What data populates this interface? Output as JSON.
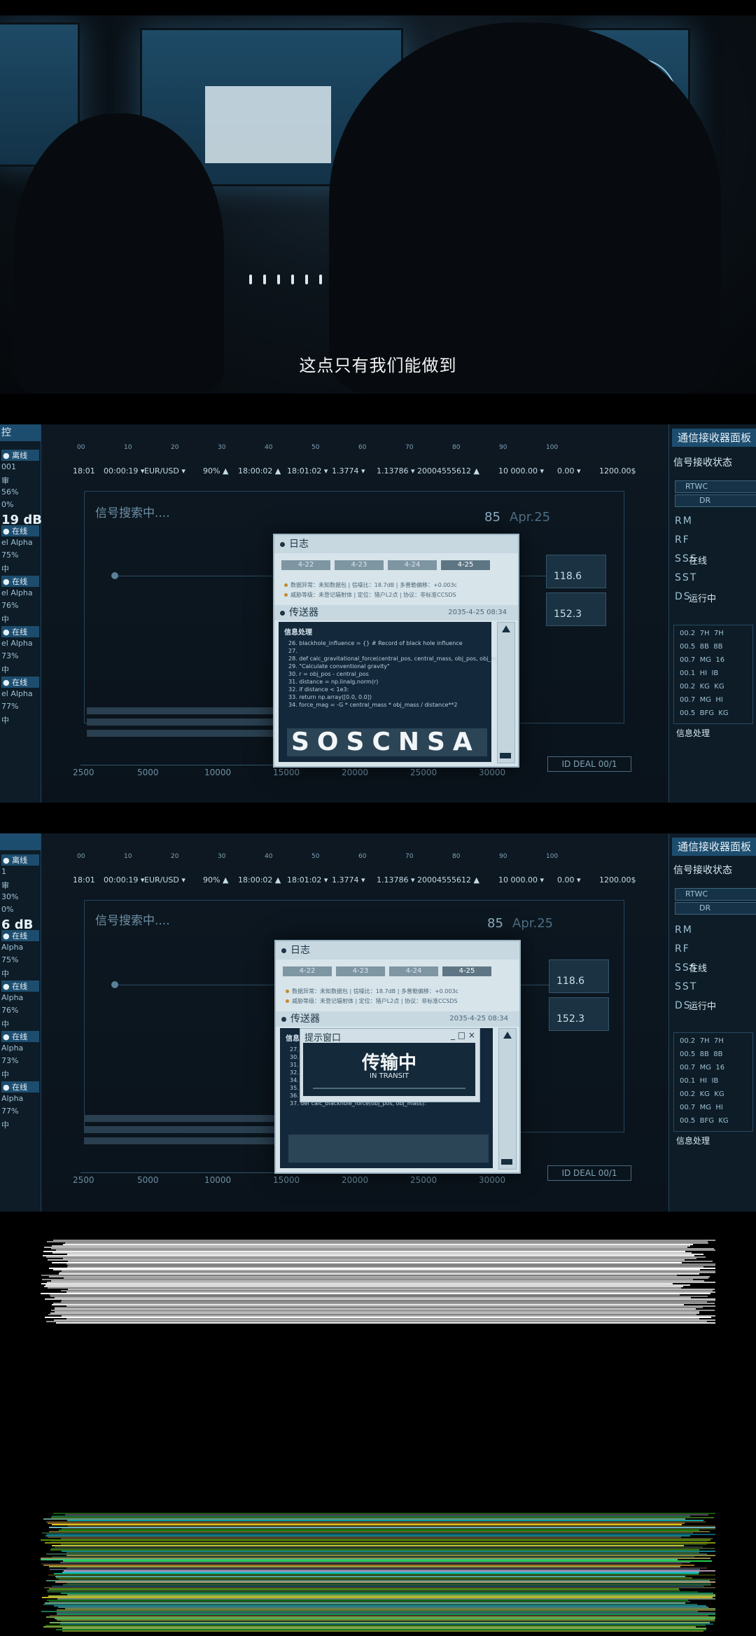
{
  "frame1": {
    "subtitle": "这点只有我们能做到"
  },
  "dashboard": {
    "left_header": "控",
    "left_rows_a": [
      "● 离线",
      "001",
      "审",
      "56%",
      "0%",
      "19 dB",
      "● 在线",
      "el Alpha",
      "75%",
      "中",
      "● 在线",
      "el Alpha",
      "76%",
      "中",
      "● 在线",
      "el Alpha",
      "73%",
      "中",
      "● 在线",
      "el Alpha",
      "77%",
      "中"
    ],
    "left_rows_b": [
      "● 离线",
      "1",
      "审",
      "30%",
      "0%",
      "6 dB",
      "● 在线",
      "Alpha",
      "75%",
      "中",
      "● 在线",
      "Alpha",
      "76%",
      "中",
      "● 在线",
      "Alpha",
      "73%",
      "中",
      "● 在线",
      "Alpha",
      "77%",
      "中"
    ],
    "top_scale": [
      "00",
      "10",
      "20",
      "30",
      "40",
      "50",
      "60",
      "70",
      "80",
      "90",
      "100"
    ],
    "ticker": [
      "18:01",
      "00:00:19 ▾",
      "EUR/USD ▾",
      "90% ▲",
      "18:00:02 ▲",
      "18:01:02 ▾",
      "1.3774 ▾",
      "1.13786 ▾",
      "20004555612 ▲",
      "10 000.00 ▾",
      "0.00 ▾",
      "1200.00$"
    ],
    "searching": "信号搜索中....",
    "x_ticks": [
      "2500",
      "5000",
      "10000",
      "15000",
      "20000",
      "25000",
      "30000"
    ],
    "deal_label": "ID DEAL 00/1",
    "stat_85": "85",
    "stat_date": "Apr.25",
    "card_values": [
      "118.6",
      "152.3"
    ],
    "right_title": "通信接收器面板",
    "right_subtitle": "信号接收状态",
    "right_chips": [
      "RTWC",
      "DR"
    ],
    "right_rows": [
      "RM",
      "RF",
      "SSS",
      "SST",
      "DS"
    ],
    "right_status": [
      "在线",
      "运行中"
    ],
    "right_code_title": "信息处理",
    "right_table": [
      "00.2  7H  7H",
      "00.5  8B  8B",
      "00.7  MG  16",
      "00.1  HI  IB",
      "00.2  KG  KG",
      "00.7  MG  HI",
      "00.5  BFG  KG"
    ]
  },
  "window": {
    "log_title": "日志",
    "tabs": [
      "4-22",
      "4-23",
      "4-24",
      "4-25"
    ],
    "log_lines": [
      "数据异常：未知数据包  |  信噪比：18.7dB  |  多普勒偏移：+0.003c",
      "威胁等级：未登记辐射体  |  定位：猎户L2点  |  协议：非标准CCSDS"
    ],
    "transmit_title": "传送器",
    "transmit_time": "2035-4-25 08:34",
    "info_title": "信息处理",
    "code_a": [
      "26. blackhole_influence = {} # Record of black hole influence",
      "27.",
      "28. def calc_gravitational_force(central_pos, central_mass, obj_pos, obj_mass):",
      "29.   \"Calculate conventional gravity\"",
      "30.     r = obj_pos - central_pos",
      "31.     distance = np.linalg.norm(r)",
      "32.     if distance < 1e3:",
      "33.        return np.array([0.0, 0.0])",
      "34.     force_mag = -G * central_mass * obj_mass / distance**2"
    ],
    "code_b": [
      "27. \"Cal...",
      "30.  r = ...",
      "31.  dis...",
      "32.  if ...",
      "34.  fo...",
      "35.    return force_mag * (r / distance)",
      "36.",
      "37. def calc_blackhole_force(obj_pos, obj_mass):"
    ],
    "sos_text": "SOSCNSA",
    "toast_title": "提示窗口",
    "toast_big": "传输中",
    "toast_small": "IN TRANSIT"
  }
}
